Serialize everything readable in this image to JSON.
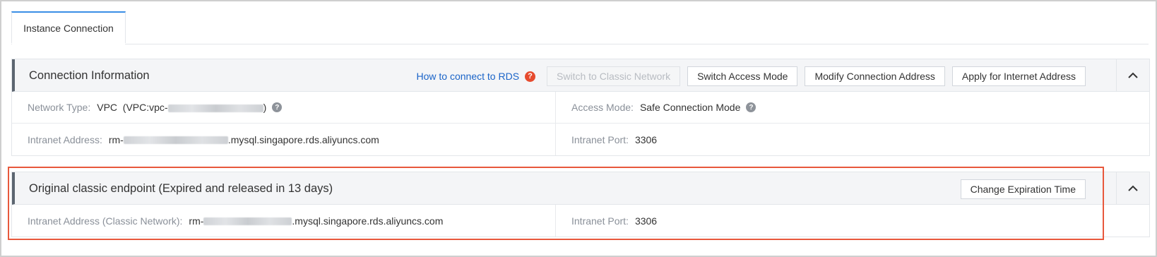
{
  "tabs": [
    {
      "label": "Instance Connection",
      "active": true
    }
  ],
  "connection_info": {
    "title": "Connection Information",
    "help_link": "How to connect to RDS",
    "buttons": {
      "switch_classic": "Switch to Classic Network",
      "switch_access_mode": "Switch Access Mode",
      "modify_address": "Modify Connection Address",
      "apply_internet": "Apply for Internet Address"
    },
    "network_type": {
      "label": "Network Type:",
      "value_prefix": "VPC  (VPC:vpc-",
      "value_suffix": ")"
    },
    "access_mode": {
      "label": "Access Mode:",
      "value": "Safe Connection Mode"
    },
    "intranet_address": {
      "label": "Intranet Address:",
      "prefix": "rm-",
      "suffix": ".mysql.singapore.rds.aliyuncs.com"
    },
    "intranet_port": {
      "label": "Intranet Port:",
      "value": "3306"
    }
  },
  "classic_endpoint": {
    "title": "Original classic endpoint (Expired and released in 13 days)",
    "buttons": {
      "change_expiration": "Change Expiration Time"
    },
    "intranet_address": {
      "label": "Intranet Address (Classic Network):",
      "prefix": "rm-",
      "suffix": ".mysql.singapore.rds.aliyuncs.com"
    },
    "intranet_port": {
      "label": "Intranet Port:",
      "value": "3306"
    }
  },
  "colors": {
    "accent": "#1a64c8",
    "highlight": "#e8583c",
    "help_red": "#e64b2e"
  },
  "icons": {
    "help": "question-circle-icon",
    "collapse": "chevron-up-icon"
  }
}
